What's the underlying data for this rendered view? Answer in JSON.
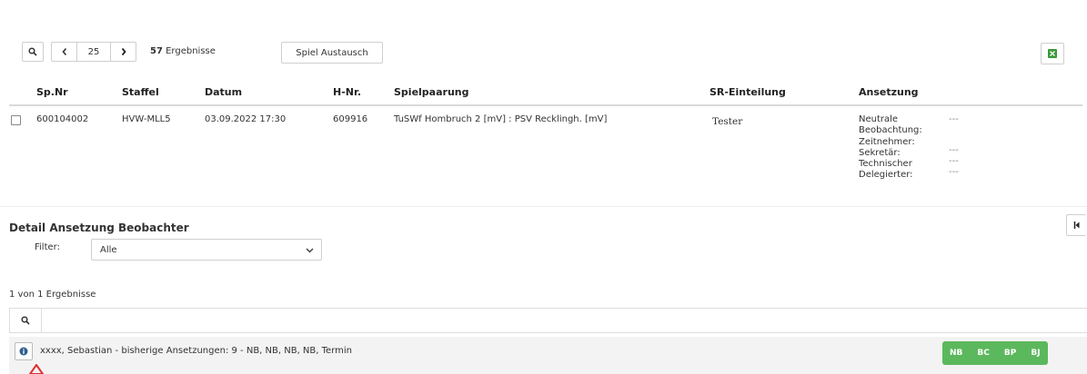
{
  "toolbar": {
    "page_size": "25",
    "results_count": "57",
    "results_label": "Ergebnisse",
    "swap_button": "Spiel Austausch"
  },
  "table": {
    "headers": {
      "spnr": "Sp.Nr",
      "staffel": "Staffel",
      "datum": "Datum",
      "hnr": "H-Nr.",
      "spielpaarung": "Spielpaarung",
      "sr": "SR-Einteilung",
      "ansetzung": "Ansetzung"
    },
    "row": {
      "spnr": "600104002",
      "staffel": "HVW-MLL5",
      "datum": "03.09.2022 17:30",
      "hnr": "609916",
      "spielpaarung": "TuSWf Hombruch 2 [mV] : PSV Recklingh. [mV]",
      "sr": "Tester",
      "ansetzung": {
        "neutrale": "Neutrale",
        "beobachtung": "Beobachtung:",
        "neutrale_value": "---",
        "zeitnehmer": "Zeitnehmer:",
        "zeitnehmer_value": "---",
        "sekretaer": "Sekretär:",
        "sekretaer_value": "---",
        "technischer": "Technischer",
        "delegierter": "Delegierter:",
        "technischer_value": "---"
      }
    }
  },
  "detail": {
    "title": "Detail Ansetzung Beobachter",
    "filter_label": "Filter:",
    "filter_value": "Alle",
    "results_text": "1 von 1 Ergebnisse",
    "observer_text": "xxxx, Sebastian - bisherige Ansetzungen: 9 - NB, NB, NB, NB, Termin",
    "badges": [
      "NB",
      "BC",
      "BP",
      "BJ"
    ]
  },
  "colors": {
    "badge_green": "#5cb85c",
    "row_bg": "#f3f3f3",
    "header_border": "#d9d9d9",
    "warning_red": "#e03030",
    "export_green": "#3a9a3a",
    "info_blue": "#2e5f8f"
  },
  "icons": {
    "search": "search-icon",
    "prev": "chevron-left-icon",
    "next": "chevron-right-icon",
    "export": "excel-export-icon",
    "collapse": "collapse-icon",
    "info": "info-icon",
    "warning": "warning-triangle-icon",
    "dropdown": "chevron-down-icon"
  }
}
